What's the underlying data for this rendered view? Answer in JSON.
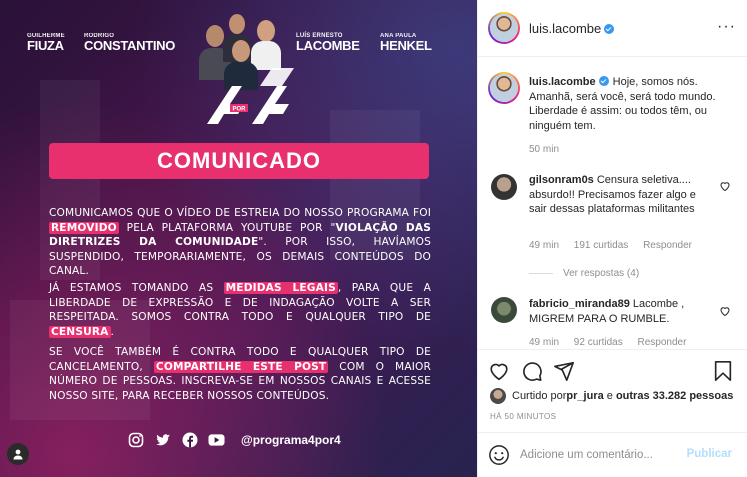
{
  "post_image": {
    "hosts": [
      {
        "first": "GUILHERME",
        "last": "FIUZA"
      },
      {
        "first": "RODRIGO",
        "last": "CONSTANTINO"
      },
      {
        "first": "LUÍS ERNESTO",
        "last": "LACOMBE"
      },
      {
        "first": "ANA PAULA",
        "last": "HENKEL"
      }
    ],
    "logo_small": "POR",
    "banner": "COMUNICADO",
    "para1": {
      "a": "COMUNICAMOS QUE O VÍDEO DE ESTREIA DO NOSSO PROGRAMA FOI ",
      "hl": "REMOVIDO",
      "b": " PELA PLATAFORMA YOUTUBE POR \"",
      "bold": "VIOLAÇÃO DAS DIRETRIZES DA COMUNIDADE",
      "c": "\". POR ISSO, HAVÍAMOS SUSPENDIDO, TEMPORARIAMENTE, OS DEMAIS CONTEÚDOS DO CANAL."
    },
    "para2": {
      "a": "JÁ ESTAMOS TOMANDO AS ",
      "hl": "MEDIDAS LEGAIS",
      "b": ", PARA QUE A LIBERDADE DE EXPRESSÃO E DE INDAGAÇÃO VOLTE A SER RESPEITADA. SOMOS CONTRA TODO E QUALQUER TIPO DE ",
      "hl2": "CENSURA",
      "c": "."
    },
    "para3": {
      "a": "SE VOCÊ TAMBÉM É CONTRA TODO E QUALQUER TIPO DE CANCELAMENTO, ",
      "hl": "COMPARTILHE ESTE POST",
      "b": " COM O MAIOR NÚMERO DE PESSOAS. INSCREVA-SE EM NOSSOS CANAIS E ACESSE NOSSO SITE, PARA RECEBER NOSSOS CONTEÚDOS."
    },
    "social_handle": "@programa4por4",
    "social_icons": [
      "instagram-icon",
      "twitter-icon",
      "facebook-icon",
      "youtube-icon"
    ],
    "brand_color": "#e8306f"
  },
  "header": {
    "username": "luis.lacombe",
    "more": "···"
  },
  "caption": {
    "username": "luis.lacombe",
    "text": "Hoje, somos nós. Amanhã, será você, será todo mundo. Liberdade é assim: ou todos têm, ou ninguém tem.",
    "time": "50 min"
  },
  "comments": [
    {
      "username": "gilsonram0s",
      "text": "Censura seletiva.... absurdo!! Precisamos fazer algo e sair dessas plataformas militantes",
      "time": "49 min",
      "likes": "191 curtidas",
      "reply": "Responder",
      "view_replies": "Ver respostas (4)"
    },
    {
      "username": "fabricio_miranda89",
      "text": "Lacombe , MIGREM PARA O RUMBLE.",
      "time": "49 min",
      "likes": "92 curtidas",
      "reply": "Responder"
    }
  ],
  "likes_summary": {
    "prefix": "Curtido por ",
    "user": "pr_jura",
    "middle": " e ",
    "others": "outras 33.282 pessoas"
  },
  "post_time": "HÁ 50 MINUTOS",
  "add_comment": {
    "placeholder": "Adicione um comentário...",
    "publish": "Publicar"
  },
  "colors": {
    "verified": "#3897f0",
    "muted": "#8e8e8e",
    "publish_disabled": "#b2dffc"
  }
}
